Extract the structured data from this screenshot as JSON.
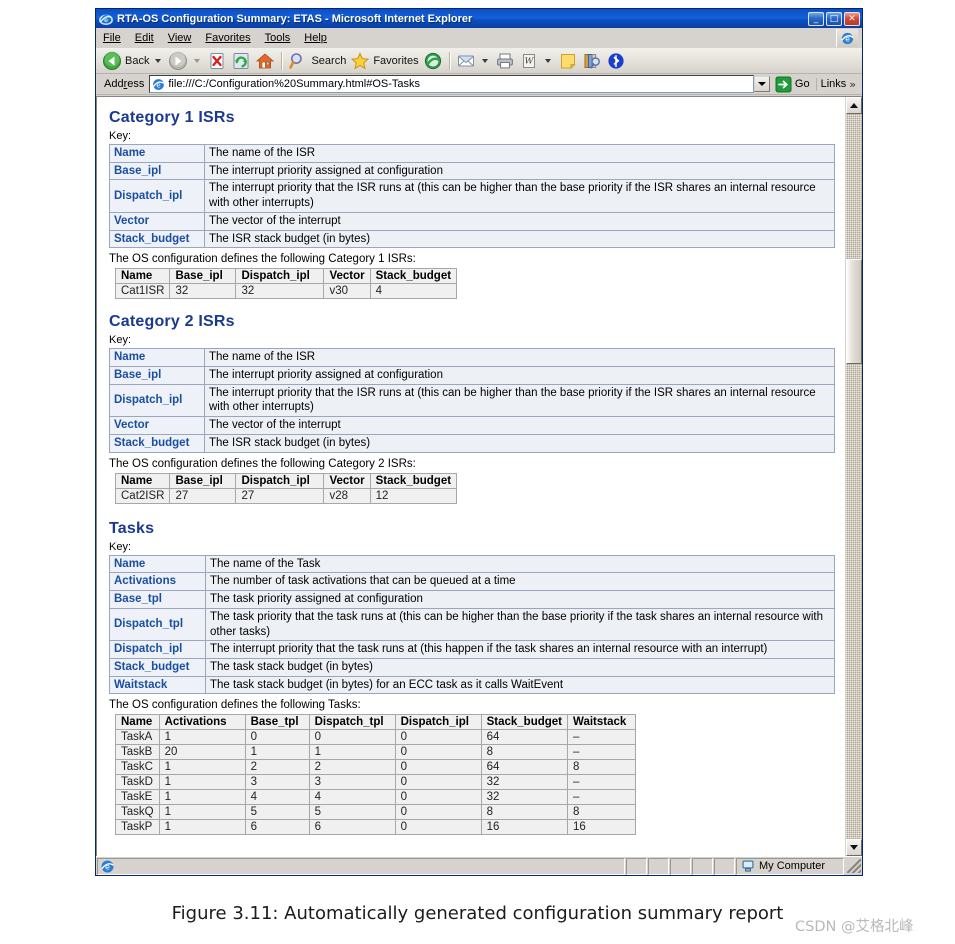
{
  "window": {
    "title": "RTA-OS Configuration Summary: ETAS - Microsoft Internet Explorer",
    "app_icon": "ie-logo-icon",
    "minimize_glyph": "_",
    "maximize_glyph": "□",
    "close_glyph": "✕"
  },
  "menubar": {
    "items": [
      {
        "label": "File",
        "accel": "F"
      },
      {
        "label": "Edit",
        "accel": "E"
      },
      {
        "label": "View",
        "accel": "V"
      },
      {
        "label": "Favorites",
        "accel": "a"
      },
      {
        "label": "Tools",
        "accel": "T"
      },
      {
        "label": "Help",
        "accel": "H"
      }
    ]
  },
  "toolbar": {
    "back_label": "Back",
    "forward_label": "",
    "stop_label": "",
    "refresh_label": "",
    "home_label": "",
    "search_label": "Search",
    "favorites_label": "Favorites",
    "history_label": "",
    "mail_label": "",
    "print_label": "",
    "edit_word_label": "",
    "notes_label": "",
    "research_label": "",
    "messenger_label": ""
  },
  "addressbar": {
    "label": "Address",
    "url": "file:///C:/Configuration%20Summary.html#OS-Tasks",
    "placeholder": "",
    "go_label": "Go",
    "links_label": "Links",
    "links_chevron": "»"
  },
  "statusbar": {
    "message": "",
    "zone": "My Computer"
  },
  "document": {
    "sections": [
      {
        "id": "category-1-isrs",
        "heading": "Category 1 ISRs",
        "key_label": "Key:",
        "key_rows": [
          {
            "term": "Name",
            "desc": "The name of the ISR"
          },
          {
            "term": "Base_ipl",
            "desc": "The interrupt priority assigned at configuration"
          },
          {
            "term": "Dispatch_ipl",
            "desc": "The interrupt priority that the ISR runs at (this can be higher than the base priority if the ISR shares an internal resource with other interrupts)"
          },
          {
            "term": "Vector",
            "desc": "The vector of the interrupt"
          },
          {
            "term": "Stack_budget",
            "desc": "The ISR stack budget (in bytes)"
          }
        ],
        "lead": "The OS configuration defines the following Category 1 ISRs:",
        "columns": [
          "Name",
          "Base_ipl",
          "Dispatch_ipl",
          "Vector",
          "Stack_budget"
        ],
        "rows": [
          [
            "Cat1ISR",
            "32",
            "32",
            "v30",
            "4"
          ]
        ]
      },
      {
        "id": "category-2-isrs",
        "heading": "Category 2 ISRs",
        "key_label": "Key:",
        "key_rows": [
          {
            "term": "Name",
            "desc": "The name of the ISR"
          },
          {
            "term": "Base_ipl",
            "desc": "The interrupt priority assigned at configuration"
          },
          {
            "term": "Dispatch_ipl",
            "desc": "The interrupt priority that the ISR runs at (this can be higher than the base priority if the ISR shares an internal resource with other interrupts)"
          },
          {
            "term": "Vector",
            "desc": "The vector of the interrupt"
          },
          {
            "term": "Stack_budget",
            "desc": "The ISR stack budget (in bytes)"
          }
        ],
        "lead": "The OS configuration defines the following Category 2 ISRs:",
        "columns": [
          "Name",
          "Base_ipl",
          "Dispatch_ipl",
          "Vector",
          "Stack_budget"
        ],
        "rows": [
          [
            "Cat2ISR",
            "27",
            "27",
            "v28",
            "12"
          ]
        ]
      },
      {
        "id": "tasks",
        "heading": "Tasks",
        "key_label": "Key:",
        "key_rows": [
          {
            "term": "Name",
            "desc": "The name of the Task"
          },
          {
            "term": "Activations",
            "desc": "The number of task activations that can be queued at a time"
          },
          {
            "term": "Base_tpl",
            "desc": "The task priority assigned at configuration"
          },
          {
            "term": "Dispatch_tpl",
            "desc": "The task priority that the task runs at (this can be higher than the base priority if the task shares an internal resource with other tasks)"
          },
          {
            "term": "Dispatch_ipl",
            "desc": "The interrupt priority that the task runs at (this happen if the task shares an internal resource with an interrupt)"
          },
          {
            "term": "Stack_budget",
            "desc": "The task stack budget (in bytes)"
          },
          {
            "term": "Waitstack",
            "desc": "The task stack budget (in bytes) for an ECC task as it calls WaitEvent"
          }
        ],
        "lead": "The OS configuration defines the following Tasks:",
        "columns": [
          "Name",
          "Activations",
          "Base_tpl",
          "Dispatch_tpl",
          "Dispatch_ipl",
          "Stack_budget",
          "Waitstack"
        ],
        "rows": [
          [
            "TaskA",
            "1",
            "0",
            "0",
            "0",
            "64",
            "–"
          ],
          [
            "TaskB",
            "20",
            "1",
            "1",
            "0",
            "8",
            "–"
          ],
          [
            "TaskC",
            "1",
            "2",
            "2",
            "0",
            "64",
            "8"
          ],
          [
            "TaskD",
            "1",
            "3",
            "3",
            "0",
            "32",
            "–"
          ],
          [
            "TaskE",
            "1",
            "4",
            "4",
            "0",
            "32",
            "–"
          ],
          [
            "TaskQ",
            "1",
            "5",
            "5",
            "0",
            "8",
            "8"
          ],
          [
            "TaskP",
            "1",
            "6",
            "6",
            "0",
            "16",
            "16"
          ]
        ]
      }
    ]
  },
  "caption": "Figure 3.11: Automatically generated configuration summary report",
  "watermark": "CSDN @艾格北峰",
  "colors": {
    "heading_blue": "#1a3a8f",
    "key_term_blue": "#1a4fa0",
    "key_row_bg": "#edf0f5",
    "data_bg": "#f0f0f0",
    "titlebar_blue": "#0b4ec0"
  }
}
